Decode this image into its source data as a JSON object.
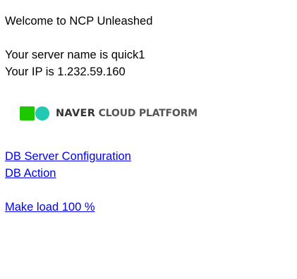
{
  "welcome_text": "Welcome to NCP Unleashed",
  "server_name_text": "Your server name is quick1",
  "ip_text": "Your IP is 1.232.59.160",
  "logo": {
    "primary_word": "NAVER",
    "secondary_words": "CLOUD PLATFORM",
    "colors": {
      "square": "#1ec800",
      "circle": "#20c9b0",
      "wordmark": "#333333"
    }
  },
  "links": {
    "db_server_config": "DB Server Configuration",
    "db_action": "DB Action",
    "make_load": "Make load 100 %"
  },
  "link_color": "#0000ee"
}
